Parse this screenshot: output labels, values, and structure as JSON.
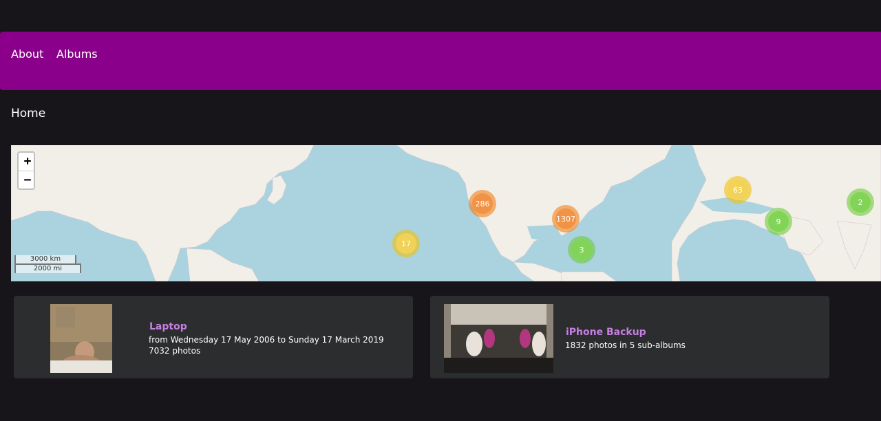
{
  "nav": {
    "items": [
      {
        "label": "About"
      },
      {
        "label": "Albums"
      }
    ]
  },
  "page": {
    "title": "Home"
  },
  "map": {
    "zoom_in": "+",
    "zoom_out": "−",
    "scale_km": "3000 km",
    "scale_mi": "2000 mi",
    "clusters": [
      {
        "count": "286",
        "size": "large"
      },
      {
        "count": "1307",
        "size": "large"
      },
      {
        "count": "17",
        "size": "medium"
      },
      {
        "count": "63",
        "size": "medium"
      },
      {
        "count": "3",
        "size": "small"
      },
      {
        "count": "9",
        "size": "small"
      },
      {
        "count": "2",
        "size": "small"
      }
    ]
  },
  "albums": [
    {
      "title": "Laptop",
      "line1": "from Wednesday 17 May 2006 to Sunday 17 March 2019",
      "line2": "7032 photos"
    },
    {
      "title": "iPhone Backup",
      "line1": "1832 photos in 5 sub-albums"
    }
  ],
  "colors": {
    "navbar": "#8a008a",
    "background": "#18151a",
    "card": "#2b2d2f",
    "album_title": "#c67fe0",
    "ocean": "#aad3df",
    "land": "#f2efe9"
  }
}
